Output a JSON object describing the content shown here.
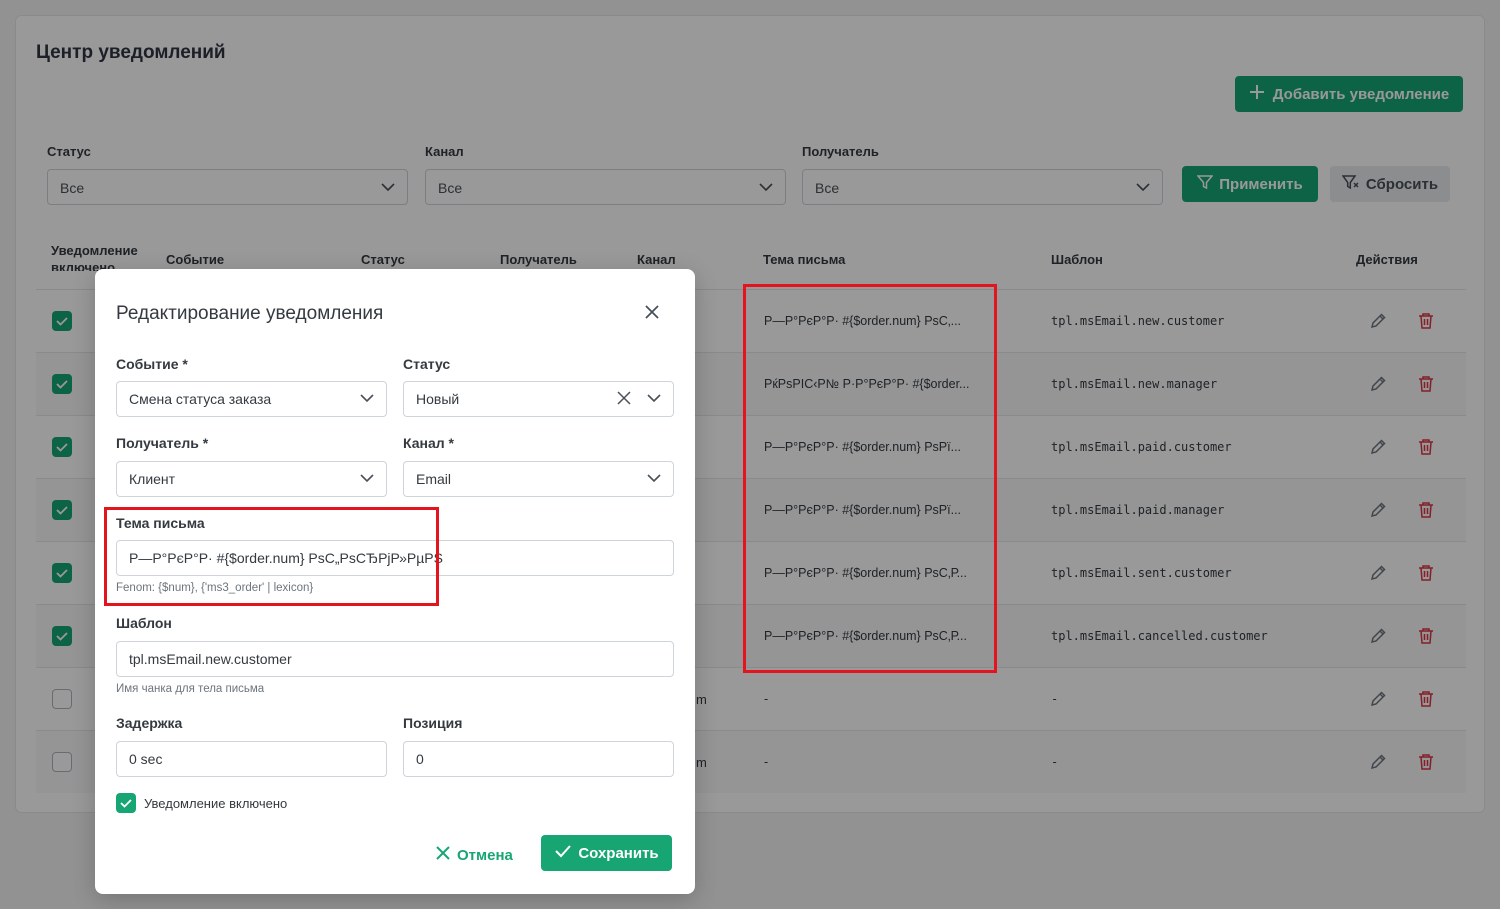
{
  "page": {
    "title": "Центр уведомлений",
    "add_button": "Добавить уведомление"
  },
  "filters": {
    "status": {
      "label": "Статус",
      "value": "Все"
    },
    "channel": {
      "label": "Канал",
      "value": "Все"
    },
    "recipient": {
      "label": "Получатель",
      "value": "Все"
    },
    "apply_label": "Применить",
    "reset_label": "Сбросить"
  },
  "table": {
    "headers": {
      "enabled_line1": "Уведомление",
      "enabled_line2": "включено",
      "event": "Событие",
      "status": "Статус",
      "recipient": "Получатель",
      "channel": "Канал",
      "subject": "Тема письма",
      "template": "Шаблон",
      "actions": "Действия"
    },
    "rows": [
      {
        "enabled": true,
        "subject": "Р—Р°РєР°Р· #{$order.num} РѕС‚...",
        "template": "tpl.msEmail.new.customer",
        "channel": ""
      },
      {
        "enabled": true,
        "subject": "РќРѕРІС‹Р№ Р·Р°РєР°Р· #{$order...",
        "template": "tpl.msEmail.new.manager",
        "channel": ""
      },
      {
        "enabled": true,
        "subject": "Р—Р°РєР°Р· #{$order.num} РѕРї...",
        "template": "tpl.msEmail.paid.customer",
        "channel": ""
      },
      {
        "enabled": true,
        "subject": "Р—Р°РєР°Р· #{$order.num} РѕРї...",
        "template": "tpl.msEmail.paid.manager",
        "channel": ""
      },
      {
        "enabled": true,
        "subject": "Р—Р°РєР°Р· #{$order.num} РѕС‚Р...",
        "template": "tpl.msEmail.sent.customer",
        "channel": ""
      },
      {
        "enabled": true,
        "subject": "Р—Р°РєР°Р· #{$order.num} РѕС‚Р...",
        "template": "tpl.msEmail.cancelled.customer",
        "channel": ""
      },
      {
        "enabled": false,
        "subject": "-",
        "template": "-",
        "channel": "m"
      },
      {
        "enabled": false,
        "subject": "-",
        "template": "-",
        "channel": "m"
      }
    ]
  },
  "modal": {
    "title": "Редактирование уведомления",
    "event": {
      "label": "Событие *",
      "value": "Смена статуса заказа"
    },
    "status": {
      "label": "Статус",
      "value": "Новый"
    },
    "recipient": {
      "label": "Получатель *",
      "value": "Клиент"
    },
    "channel": {
      "label": "Канал *",
      "value": "Email"
    },
    "subject": {
      "label": "Тема письма",
      "value": "Р—Р°РєР°Р· #{$order.num} РѕС„РѕСЂРјР»РµРЅ",
      "hint": "Fenom: {$num}, {'ms3_order' | lexicon}"
    },
    "template": {
      "label": "Шаблон",
      "value": "tpl.msEmail.new.customer",
      "hint": "Имя чанка для тела письма"
    },
    "delay": {
      "label": "Задержка",
      "value": "0 sec"
    },
    "position": {
      "label": "Позиция",
      "value": "0"
    },
    "enabled_label": "Уведомление включено",
    "cancel_label": "Отмена",
    "save_label": "Сохранить"
  },
  "colors": {
    "accent": "#17a673",
    "danger": "#e3141d",
    "delete_icon": "#dc3545"
  }
}
